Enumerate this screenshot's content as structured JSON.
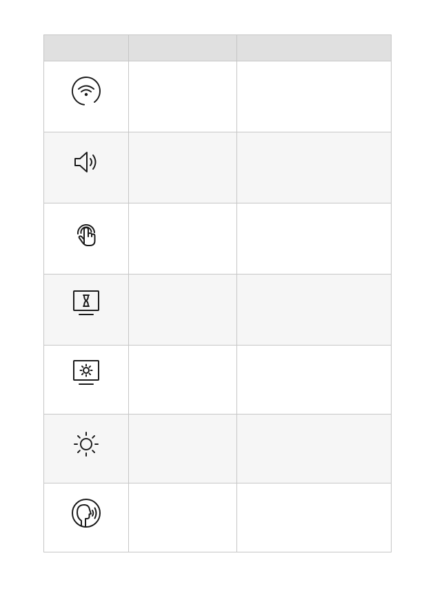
{
  "table": {
    "headers": [
      "",
      "",
      ""
    ],
    "rows": [
      {
        "icon": "wifi-icon",
        "col2": "",
        "col3": ""
      },
      {
        "icon": "volume-icon",
        "col2": "",
        "col3": ""
      },
      {
        "icon": "touch-gesture-icon",
        "col2": "",
        "col3": ""
      },
      {
        "icon": "monitor-hourglass-icon",
        "col2": "",
        "col3": ""
      },
      {
        "icon": "monitor-brightness-icon",
        "col2": "",
        "col3": ""
      },
      {
        "icon": "brightness-sun-icon",
        "col2": "",
        "col3": ""
      },
      {
        "icon": "voice-speaking-icon",
        "col2": "",
        "col3": ""
      }
    ]
  },
  "colors": {
    "header_bg": "#e0e0e0",
    "row_alt_bg": "#f6f6f6",
    "border": "#c6c6c6",
    "icon": "#1a1a1a"
  }
}
